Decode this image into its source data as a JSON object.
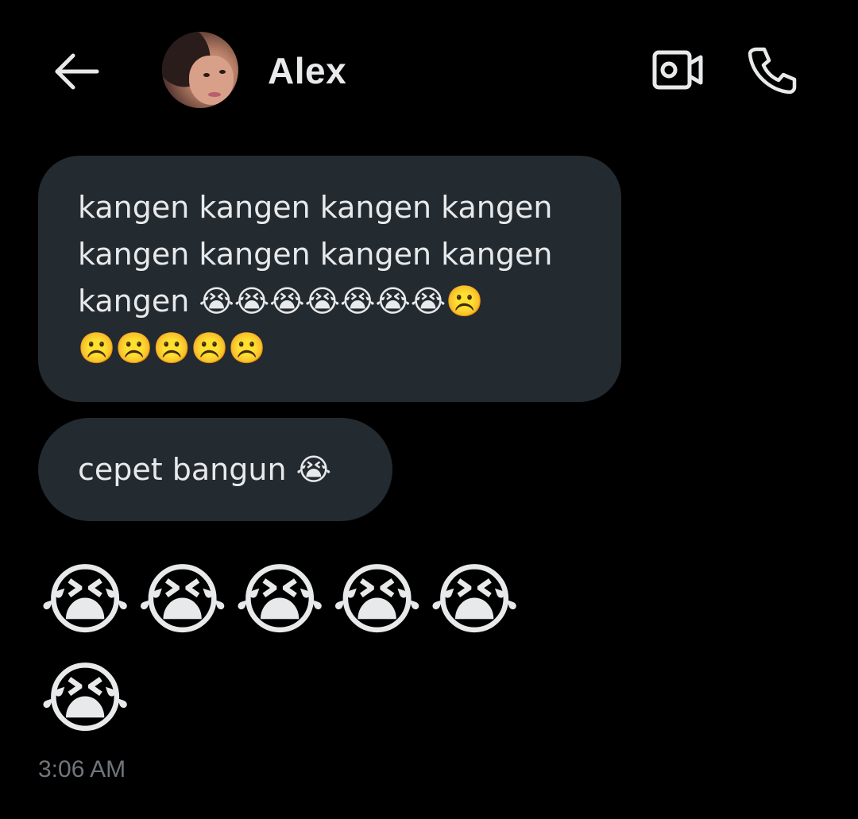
{
  "header": {
    "back_icon": "arrow-left-icon",
    "contact_name": "Alex",
    "video_icon": "video-camera-icon",
    "call_icon": "phone-icon"
  },
  "messages": [
    {
      "text": "kangen kangen kangen kangen\nkangen kangen kangen kangen\nkangen 😭😭😭😭😭😭😭☹️\n☹️☹️☹️☹️☹️"
    },
    {
      "text": "cepet bangun 😭"
    },
    {
      "text": "😭😭😭😭😭\n😭"
    }
  ],
  "timestamp": "3:06 AM",
  "colors": {
    "background": "#000000",
    "bubble": "#232a30",
    "text": "#e7e9ea",
    "muted": "#71767b"
  }
}
